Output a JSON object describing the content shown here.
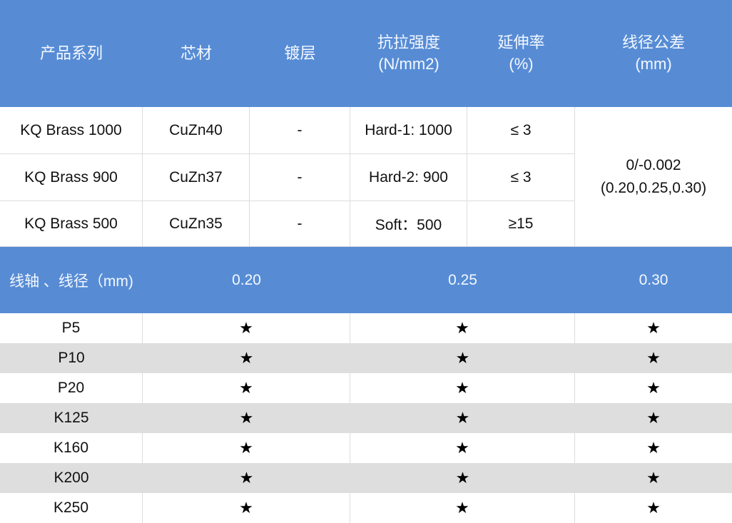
{
  "header": {
    "series": "产品系列",
    "core": "芯材",
    "coating": "镀层",
    "tensile_line1": "抗拉强度",
    "tensile_line2": "(N/mm2)",
    "elongation_line1": "延伸率",
    "elongation_line2": "(%)",
    "tolerance_line1": "线径公差",
    "tolerance_line2": "(mm)"
  },
  "products": [
    {
      "series": "KQ Brass 1000",
      "core": "CuZn40",
      "coating": "-",
      "tensile": "Hard-1: 1000",
      "elongation": "≤ 3"
    },
    {
      "series": "KQ Brass 900",
      "core": "CuZn37",
      "coating": "-",
      "tensile": "Hard-2:  900",
      "elongation": "≤ 3"
    },
    {
      "series": "KQ Brass 500",
      "core": "CuZn35",
      "coating": "-",
      "tensile": "Soft：500",
      "elongation": "≥15"
    }
  ],
  "tolerance": {
    "line1": "0/-0.002",
    "line2": "(0.20,0.25,0.30)"
  },
  "spool_header": {
    "label": "线轴 、线径（mm)",
    "d1": "0.20",
    "d2": "0.25",
    "d3": "0.30"
  },
  "spools": [
    {
      "name": "P5",
      "d1": "★",
      "d2": "★",
      "d3": "★"
    },
    {
      "name": "P10",
      "d1": "★",
      "d2": "★",
      "d3": "★"
    },
    {
      "name": "P20",
      "d1": "★",
      "d2": "★",
      "d3": "★"
    },
    {
      "name": "K125",
      "d1": "★",
      "d2": "★",
      "d3": "★"
    },
    {
      "name": "K160",
      "d1": "★",
      "d2": "★",
      "d3": "★"
    },
    {
      "name": "K200",
      "d1": "★",
      "d2": "★",
      "d3": "★"
    },
    {
      "name": "K250",
      "d1": "★",
      "d2": "★",
      "d3": "★"
    }
  ],
  "colors": {
    "header_bg": "#578cd5",
    "stripe_bg": "#dedede",
    "header_text": "#f4f8ff"
  }
}
